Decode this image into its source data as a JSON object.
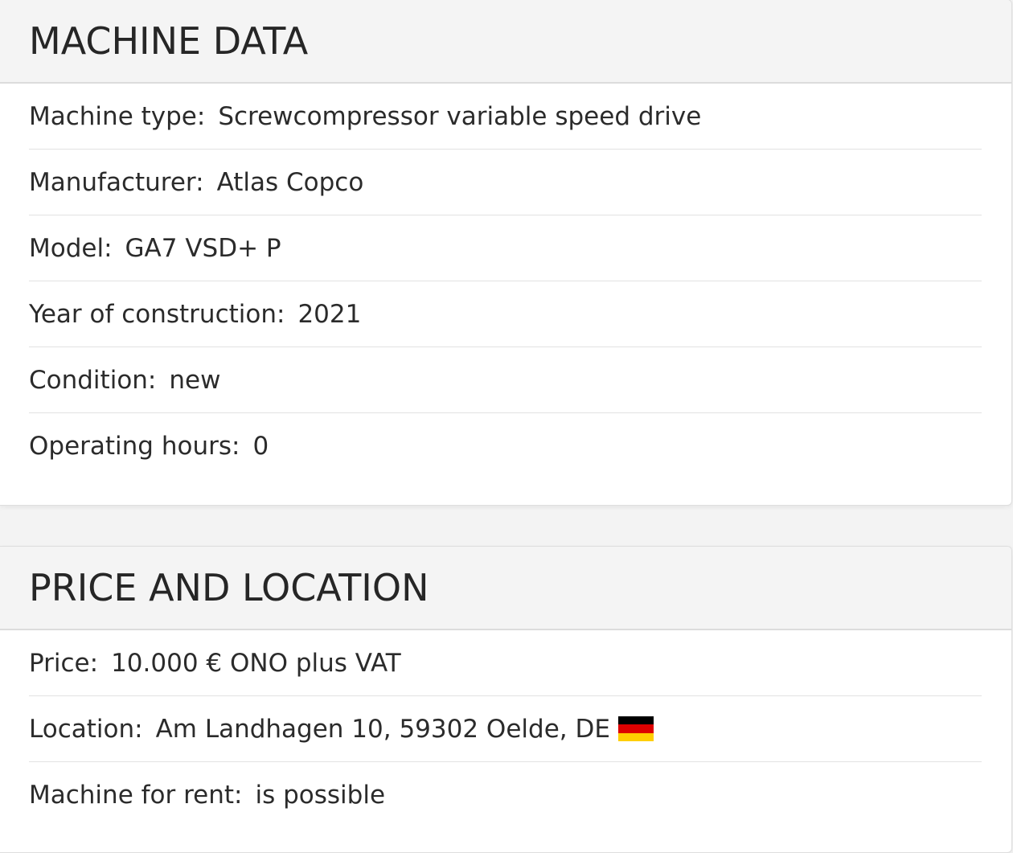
{
  "machine_data": {
    "title": "MACHINE DATA",
    "rows": [
      {
        "label": "Machine type:",
        "value": "Screwcompressor variable speed drive"
      },
      {
        "label": "Manufacturer:",
        "value": "Atlas Copco"
      },
      {
        "label": "Model:",
        "value": "GA7 VSD+ P"
      },
      {
        "label": "Year of construction:",
        "value": "2021"
      },
      {
        "label": "Condition:",
        "value": "new"
      },
      {
        "label": "Operating hours:",
        "value": "0"
      }
    ]
  },
  "price_location": {
    "title": "PRICE AND LOCATION",
    "rows": [
      {
        "label": "Price:",
        "value": "10.000 € ONO plus VAT"
      },
      {
        "label": "Location:",
        "value": "Am Landhagen 10, 59302 Oelde, DE",
        "icon": "germany-flag-icon"
      },
      {
        "label": "Machine for rent:",
        "value": "is possible"
      }
    ]
  },
  "flag_colors": [
    "#000000",
    "#dd0000",
    "#ffce00"
  ]
}
